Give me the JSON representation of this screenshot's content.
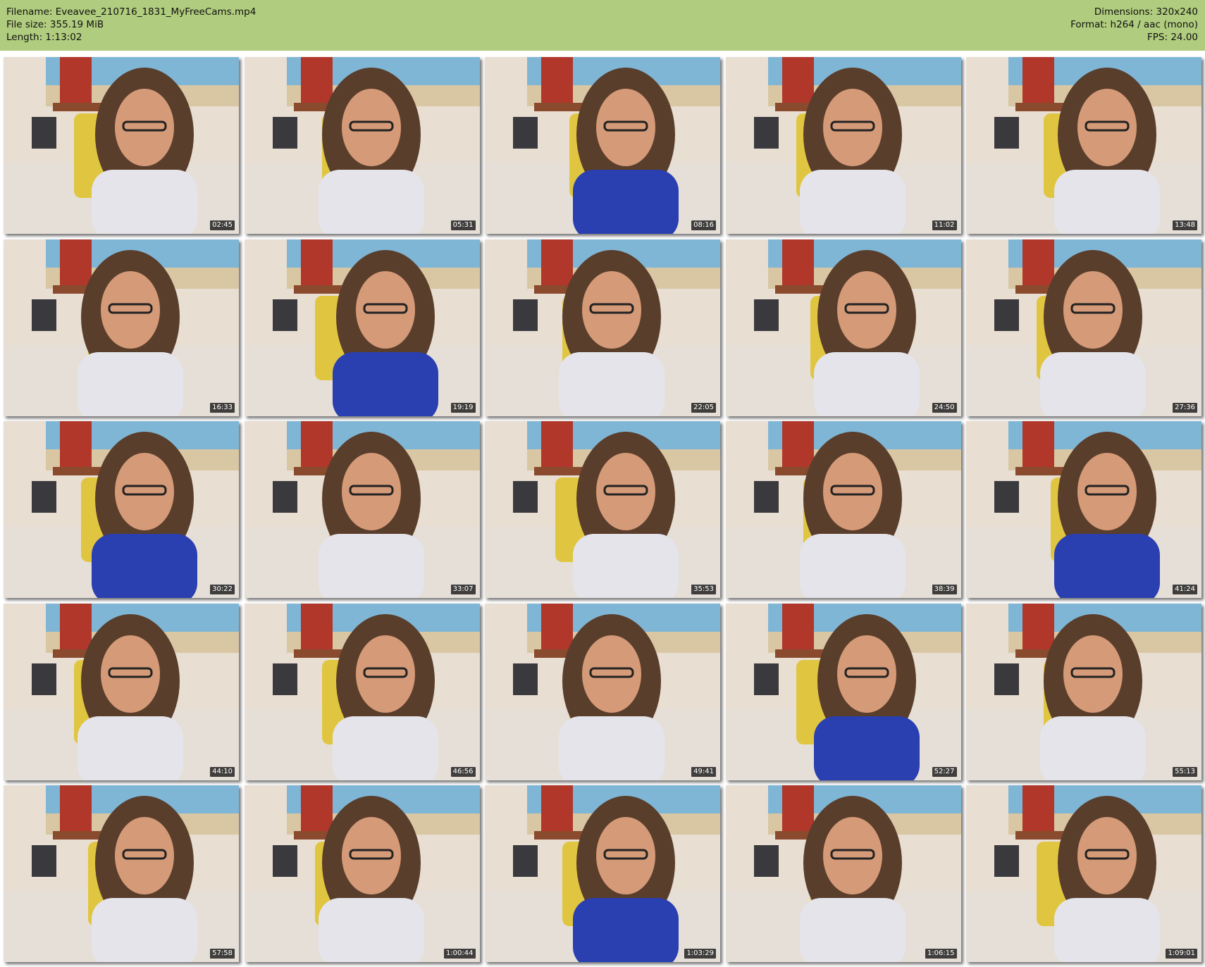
{
  "header": {
    "filename": "Filename: Eveavee_210716_1831_MyFreeCams.mp4",
    "filesize": "File size: 355.19 MiB",
    "length": "Length: 1:13:02",
    "dimensions": "Dimensions: 320x240",
    "format": "Format: h264 / aac (mono)",
    "fps": "FPS: 24.00"
  },
  "thumbnails": [
    {
      "timestamp": "02:45"
    },
    {
      "timestamp": "05:31"
    },
    {
      "timestamp": "08:16"
    },
    {
      "timestamp": "11:02"
    },
    {
      "timestamp": "13:48"
    },
    {
      "timestamp": "16:33"
    },
    {
      "timestamp": "19:19"
    },
    {
      "timestamp": "22:05"
    },
    {
      "timestamp": "24:50"
    },
    {
      "timestamp": "27:36"
    },
    {
      "timestamp": "30:22"
    },
    {
      "timestamp": "33:07"
    },
    {
      "timestamp": "35:53"
    },
    {
      "timestamp": "38:39"
    },
    {
      "timestamp": "41:24"
    },
    {
      "timestamp": "44:10"
    },
    {
      "timestamp": "46:56"
    },
    {
      "timestamp": "49:41"
    },
    {
      "timestamp": "52:27"
    },
    {
      "timestamp": "55:13"
    },
    {
      "timestamp": "57:58"
    },
    {
      "timestamp": "1:00:44"
    },
    {
      "timestamp": "1:03:29"
    },
    {
      "timestamp": "1:06:15"
    },
    {
      "timestamp": "1:09:01"
    }
  ]
}
